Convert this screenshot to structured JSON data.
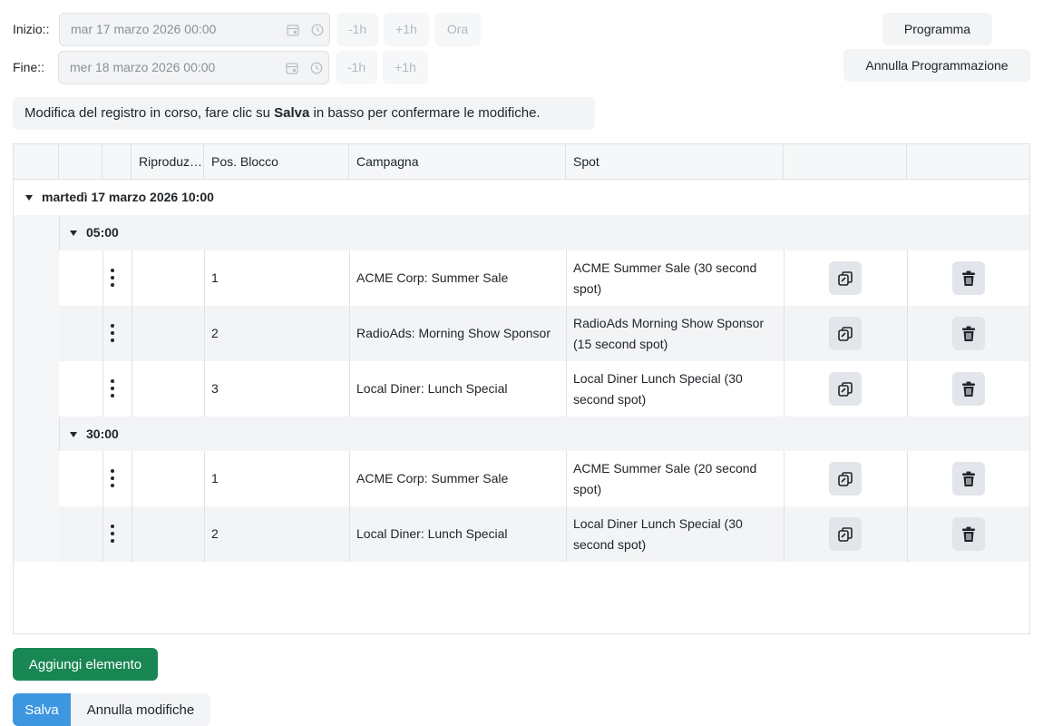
{
  "start": {
    "label": "Inizio::",
    "value": "mar 17 marzo 2026 00:00",
    "minus_label": "-1h",
    "plus_label": "+1h",
    "now_label": "Ora"
  },
  "end": {
    "label": "Fine::",
    "value": "mer 18 marzo 2026 00:00",
    "minus_label": "-1h",
    "plus_label": "+1h"
  },
  "actions": {
    "schedule_label": "Programma",
    "unschedule_label": "Annulla Programmazione"
  },
  "notice": {
    "before": "Modifica del registro in corso, fare clic su ",
    "bold": "Salva",
    "after": " in basso per confermare le modifiche."
  },
  "table": {
    "headers": [
      "",
      "",
      "",
      "Riproduzione",
      "Pos. Blocco",
      "Campagna",
      "Spot",
      "",
      ""
    ],
    "day_group": "martedì 17 marzo 2026 10:00",
    "groups": [
      {
        "label": "05:00",
        "rows": [
          {
            "pos": "1",
            "campaign": "ACME Corp: Summer Sale",
            "spot": "ACME Summer Sale (30 second spot)"
          },
          {
            "pos": "2",
            "campaign": "RadioAds: Morning Show Sponsor",
            "spot": "RadioAds Morning Show Sponsor (15 second spot)"
          },
          {
            "pos": "3",
            "campaign": "Local Diner: Lunch Special",
            "spot": "Local Diner Lunch Special (30 second spot)"
          }
        ]
      },
      {
        "label": "30:00",
        "rows": [
          {
            "pos": "1",
            "campaign": "ACME Corp: Summer Sale",
            "spot": "ACME Summer Sale (20 second spot)"
          },
          {
            "pos": "2",
            "campaign": "Local Diner: Lunch Special",
            "spot": "Local Diner Lunch Special (30 second spot)"
          }
        ]
      }
    ]
  },
  "footer": {
    "add_label": "Aggiungi elemento",
    "save_label": "Salva",
    "cancel_label": "Annulla modifiche"
  },
  "icons": [
    "calendar-icon",
    "clock-icon",
    "duplicate-icon",
    "trash-icon",
    "kebab-menu-icon",
    "caret-down-icon"
  ],
  "colors": {
    "accent": "#3d97e0",
    "success": "#198754"
  }
}
